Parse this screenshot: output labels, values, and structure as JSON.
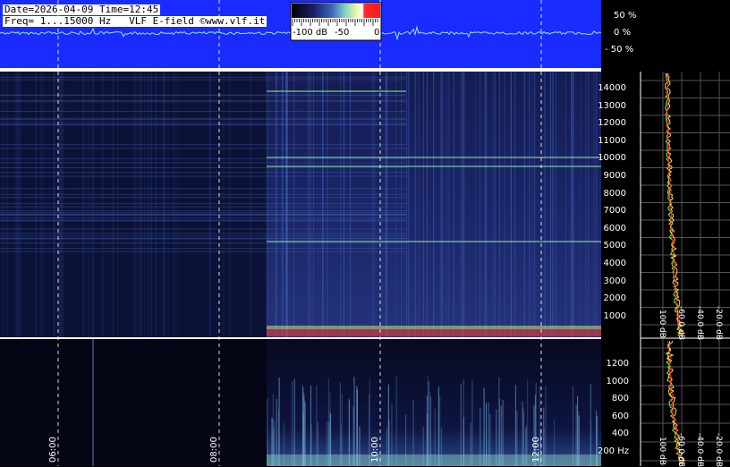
{
  "header": {
    "date_line": "Date=2026-04-09 Time=12:45",
    "freq_line": "Freq= 1...15000 Hz   VLF E-field ©www.vlf.it"
  },
  "colorbar": {
    "labels": [
      "-100 dB",
      "-50",
      "0"
    ],
    "colors": [
      "#000000",
      "#1a1f6b",
      "#3b63b8",
      "#7fd0c8",
      "#e8f4a0",
      "#ffffff",
      "#ff2a2a"
    ]
  },
  "waveform": {
    "percent_labels": [
      "50 %",
      "0 %",
      "- 50 %"
    ],
    "background": "#1a2bff",
    "trace_color": "#8fe8ff"
  },
  "upper_spectrogram": {
    "freq_labels": [
      "14000",
      "13000",
      "12000",
      "11000",
      "10000",
      "9000",
      "8000",
      "7000",
      "6000",
      "5000",
      "4000",
      "3000",
      "2000",
      "1000"
    ]
  },
  "lower_spectrogram": {
    "freq_labels": [
      "1200",
      "1000",
      "800",
      "600",
      "400",
      "200 Hz"
    ]
  },
  "time_labels": [
    "06:00",
    "08:00",
    "10:00",
    "12:00"
  ],
  "spectrum_panel_labels": [
    "100 dB",
    "-60.0 dB",
    "-40.0 dB",
    "-20.0 dB"
  ],
  "palette": {
    "spectrogram_dark": "#050818",
    "spectrogram_mid": "#1c2a6e",
    "line_green": "#8fe6a8",
    "curve_green": "#7cff5a",
    "curve_yellow": "#ffe14a",
    "curve_red": "#ff2a2a"
  }
}
